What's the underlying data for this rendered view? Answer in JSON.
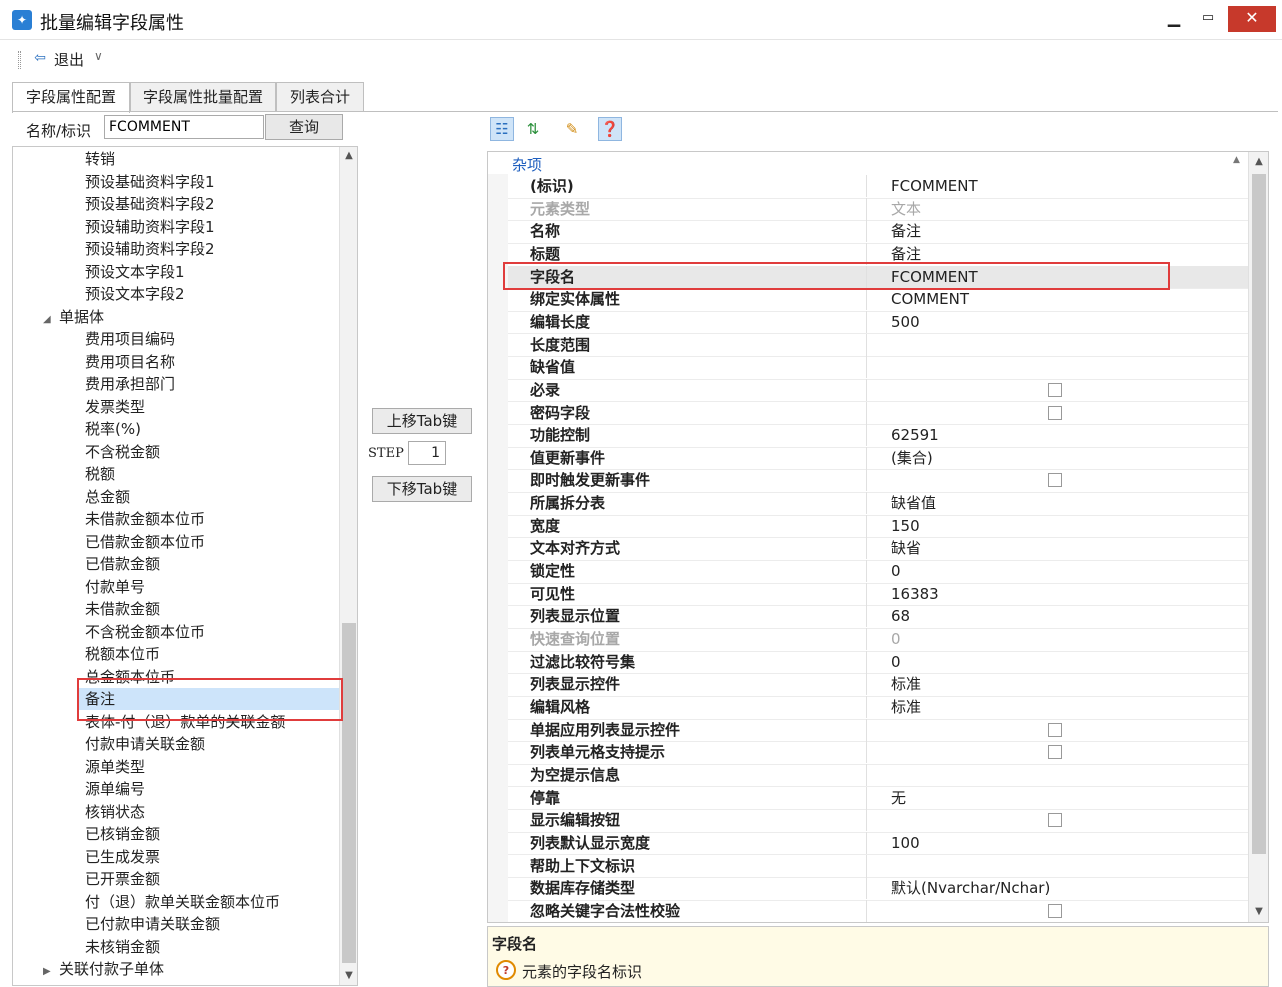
{
  "window": {
    "title": "批量编辑字段属性"
  },
  "toolbar": {
    "exit_label": "退出"
  },
  "tabs": [
    {
      "label": "字段属性配置",
      "active": true
    },
    {
      "label": "字段属性批量配置",
      "active": false
    },
    {
      "label": "列表合计",
      "active": false
    }
  ],
  "search": {
    "label": "名称/标识",
    "value": "FCOMMENT",
    "query_label": "查询"
  },
  "tree": {
    "items": [
      {
        "label": "转销",
        "level": 2
      },
      {
        "label": "预设基础资料字段1",
        "level": 2
      },
      {
        "label": "预设基础资料字段2",
        "level": 2
      },
      {
        "label": "预设辅助资料字段1",
        "level": 2
      },
      {
        "label": "预设辅助资料字段2",
        "level": 2
      },
      {
        "label": "预设文本字段1",
        "level": 2
      },
      {
        "label": "预设文本字段2",
        "level": 2
      },
      {
        "label": "单据体",
        "level": 1,
        "expander": "◢"
      },
      {
        "label": "费用项目编码",
        "level": 2
      },
      {
        "label": "费用项目名称",
        "level": 2
      },
      {
        "label": "费用承担部门",
        "level": 2
      },
      {
        "label": "发票类型",
        "level": 2
      },
      {
        "label": "税率(%)",
        "level": 2
      },
      {
        "label": "不含税金额",
        "level": 2
      },
      {
        "label": "税额",
        "level": 2
      },
      {
        "label": "总金额",
        "level": 2
      },
      {
        "label": "未借款金额本位币",
        "level": 2
      },
      {
        "label": "已借款金额本位币",
        "level": 2
      },
      {
        "label": "已借款金额",
        "level": 2
      },
      {
        "label": "付款单号",
        "level": 2
      },
      {
        "label": "未借款金额",
        "level": 2
      },
      {
        "label": "不含税金额本位币",
        "level": 2
      },
      {
        "label": "税额本位币",
        "level": 2
      },
      {
        "label": "总金额本位币",
        "level": 2
      },
      {
        "label": "备注",
        "level": 2,
        "selected": true
      },
      {
        "label": "表体-付（退）款单的关联金额",
        "level": 2
      },
      {
        "label": "付款申请关联金额",
        "level": 2
      },
      {
        "label": "源单类型",
        "level": 2
      },
      {
        "label": "源单编号",
        "level": 2
      },
      {
        "label": "核销状态",
        "level": 2
      },
      {
        "label": "已核销金额",
        "level": 2
      },
      {
        "label": "已生成发票",
        "level": 2
      },
      {
        "label": "已开票金额",
        "level": 2
      },
      {
        "label": "付（退）款单关联金额本位币",
        "level": 2
      },
      {
        "label": "已付款申请关联金额",
        "level": 2
      },
      {
        "label": "未核销金额",
        "level": 2
      },
      {
        "label": "关联付款子单体",
        "level": 1,
        "expander": "▶"
      }
    ]
  },
  "middle": {
    "move_up_label": "上移Tab键",
    "step_label": "STEP",
    "step_value": "1",
    "move_down_label": "下移Tab键"
  },
  "grid": {
    "category": "杂项",
    "rows": [
      {
        "name": "(标识)",
        "value": "FCOMMENT"
      },
      {
        "name": "元素类型",
        "value": "文本",
        "disabled": true
      },
      {
        "name": "名称",
        "value": "备注"
      },
      {
        "name": "标题",
        "value": "备注"
      },
      {
        "name": "字段名",
        "value": "FCOMMENT",
        "selected": true
      },
      {
        "name": "绑定实体属性",
        "value": "COMMENT"
      },
      {
        "name": "编辑长度",
        "value": "500"
      },
      {
        "name": "长度范围",
        "value": ""
      },
      {
        "name": "缺省值",
        "value": ""
      },
      {
        "name": "必录",
        "value": "",
        "checkbox": true
      },
      {
        "name": "密码字段",
        "value": "",
        "checkbox": true
      },
      {
        "name": "功能控制",
        "value": "62591"
      },
      {
        "name": "值更新事件",
        "value": "(集合)"
      },
      {
        "name": "即时触发更新事件",
        "value": "",
        "checkbox": true
      },
      {
        "name": "所属拆分表",
        "value": "缺省值"
      },
      {
        "name": "宽度",
        "value": "150"
      },
      {
        "name": "文本对齐方式",
        "value": "缺省"
      },
      {
        "name": "锁定性",
        "value": "0"
      },
      {
        "name": "可见性",
        "value": "16383"
      },
      {
        "name": "列表显示位置",
        "value": "68"
      },
      {
        "name": "快速查询位置",
        "value": "0",
        "disabled": true
      },
      {
        "name": "过滤比较符号集",
        "value": "0"
      },
      {
        "name": "列表显示控件",
        "value": "标准"
      },
      {
        "name": "编辑风格",
        "value": "标准"
      },
      {
        "name": "单据应用列表显示控件",
        "value": "",
        "checkbox": true
      },
      {
        "name": "列表单元格支持提示",
        "value": "",
        "checkbox": true
      },
      {
        "name": "为空提示信息",
        "value": ""
      },
      {
        "name": "停靠",
        "value": "无"
      },
      {
        "name": "显示编辑按钮",
        "value": "",
        "checkbox": true
      },
      {
        "name": "列表默认显示宽度",
        "value": "100"
      },
      {
        "name": "帮助上下文标识",
        "value": ""
      },
      {
        "name": "数据库存储类型",
        "value": "默认(Nvarchar/Nchar)"
      },
      {
        "name": "忽略关键字合法性校验",
        "value": "",
        "checkbox": true
      }
    ]
  },
  "help": {
    "title": "字段名",
    "description": "元素的字段名标识"
  },
  "colors": {
    "accent": "#2a7fd4",
    "close": "#c7392b",
    "highlight": "#e03c3c",
    "selected": "#cde4fa"
  }
}
